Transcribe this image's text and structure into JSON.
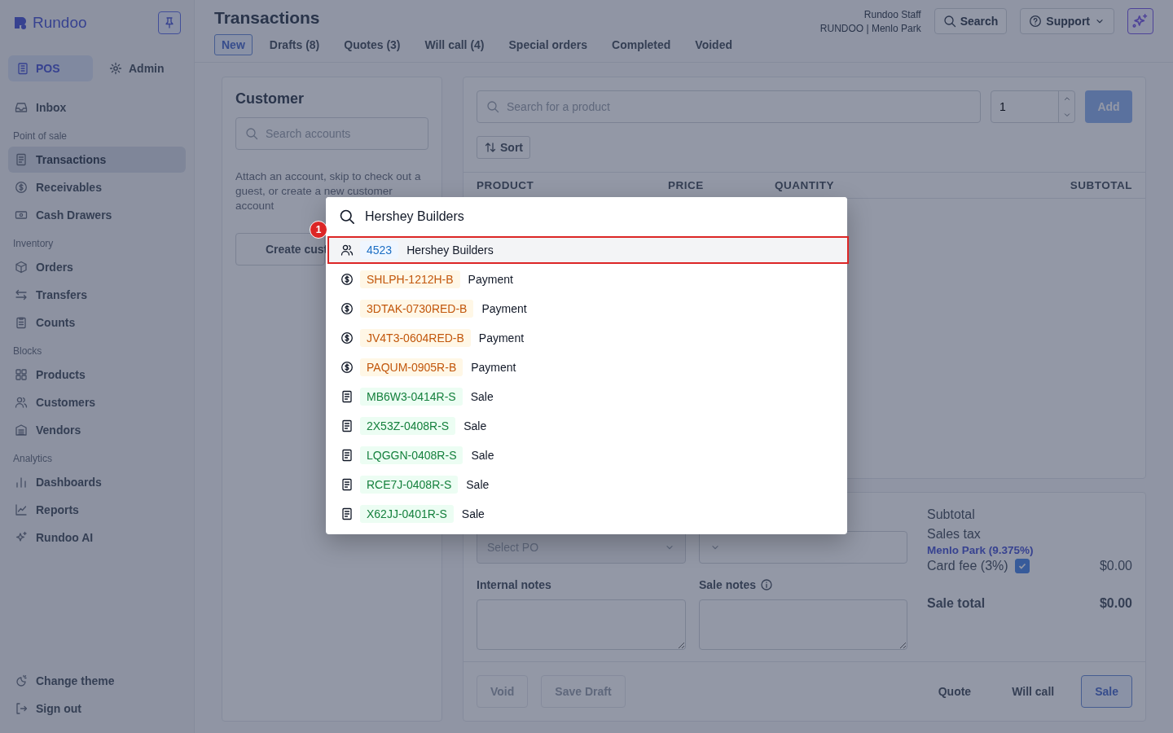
{
  "sidebar": {
    "brand": "Rundoo",
    "modes": [
      {
        "label": "POS",
        "selected": true
      },
      {
        "label": "Admin",
        "selected": false
      }
    ],
    "top_items": [
      {
        "label": "Inbox",
        "selected": false
      }
    ],
    "sections": [
      {
        "title": "Point of sale",
        "items": [
          {
            "label": "Transactions",
            "selected": true
          },
          {
            "label": "Receivables",
            "selected": false
          },
          {
            "label": "Cash Drawers",
            "selected": false
          }
        ]
      },
      {
        "title": "Inventory",
        "items": [
          {
            "label": "Orders",
            "selected": false
          },
          {
            "label": "Transfers",
            "selected": false
          },
          {
            "label": "Counts",
            "selected": false
          }
        ]
      },
      {
        "title": "Blocks",
        "items": [
          {
            "label": "Products",
            "selected": false
          },
          {
            "label": "Customers",
            "selected": false
          },
          {
            "label": "Vendors",
            "selected": false
          }
        ]
      },
      {
        "title": "Analytics",
        "items": [
          {
            "label": "Dashboards",
            "selected": false
          },
          {
            "label": "Reports",
            "selected": false
          },
          {
            "label": "Rundoo AI",
            "selected": false
          }
        ]
      }
    ],
    "bottom_items": [
      {
        "label": "Change theme"
      },
      {
        "label": "Sign out"
      }
    ]
  },
  "header": {
    "title": "Transactions",
    "tabs": [
      {
        "label": "New",
        "selected": true
      },
      {
        "label": "Drafts (8)",
        "selected": false
      },
      {
        "label": "Quotes (3)",
        "selected": false
      },
      {
        "label": "Will call (4)",
        "selected": false
      },
      {
        "label": "Special orders",
        "selected": false
      },
      {
        "label": "Completed",
        "selected": false
      },
      {
        "label": "Voided",
        "selected": false
      }
    ],
    "user": {
      "name": "Rundoo Staff",
      "store": "RUNDOO | Menlo Park"
    },
    "search_button": "Search",
    "support_button": "Support"
  },
  "customer": {
    "title": "Customer",
    "search_placeholder": "Search accounts",
    "hint": "Attach an account, skip to check out a guest, or create a new customer account",
    "create_button": "Create cust"
  },
  "products": {
    "search_placeholder": "Search for a product",
    "quantity": "1",
    "add_button": "Add",
    "sort_button": "Sort",
    "columns": [
      "PRODUCT",
      "PRICE",
      "QUANTITY",
      "SUBTOTAL"
    ]
  },
  "order": {
    "po_placeholder": "Select PO",
    "internal_notes_label": "Internal notes",
    "sale_notes_label": "Sale notes",
    "summary": {
      "subtotal_label": "Subtotal",
      "tax_label": "Sales tax",
      "tax_rate": "Menlo Park (9.375%)",
      "card_fee_label": "Card fee (3%)",
      "card_fee_checked": true,
      "card_fee_value": "$0.00",
      "total_label": "Sale total",
      "total_value": "$0.00"
    },
    "actions": [
      {
        "label": "Void",
        "kind": "muted"
      },
      {
        "label": "Save Draft",
        "kind": "muted"
      },
      {
        "label": "Quote",
        "kind": "plain"
      },
      {
        "label": "Will call",
        "kind": "plain"
      },
      {
        "label": "Sale",
        "kind": "primary"
      }
    ]
  },
  "palette": {
    "query": "Hershey Builders",
    "annotation": "1",
    "results": [
      {
        "kind": "account",
        "code": "4523",
        "label": "Hershey Builders",
        "selected": true
      },
      {
        "kind": "payment",
        "code": "SHLPH-1212H-B",
        "label": "Payment",
        "selected": false
      },
      {
        "kind": "payment",
        "code": "3DTAK-0730RED-B",
        "label": "Payment",
        "selected": false
      },
      {
        "kind": "payment",
        "code": "JV4T3-0604RED-B",
        "label": "Payment",
        "selected": false
      },
      {
        "kind": "payment",
        "code": "PAQUM-0905R-B",
        "label": "Payment",
        "selected": false
      },
      {
        "kind": "sale",
        "code": "MB6W3-0414R-S",
        "label": "Sale",
        "selected": false
      },
      {
        "kind": "sale",
        "code": "2X53Z-0408R-S",
        "label": "Sale",
        "selected": false
      },
      {
        "kind": "sale",
        "code": "LQGGN-0408R-S",
        "label": "Sale",
        "selected": false
      },
      {
        "kind": "sale",
        "code": "RCE7J-0408R-S",
        "label": "Sale",
        "selected": false
      },
      {
        "kind": "sale",
        "code": "X62JJ-0401R-S",
        "label": "Sale",
        "selected": false
      }
    ]
  }
}
